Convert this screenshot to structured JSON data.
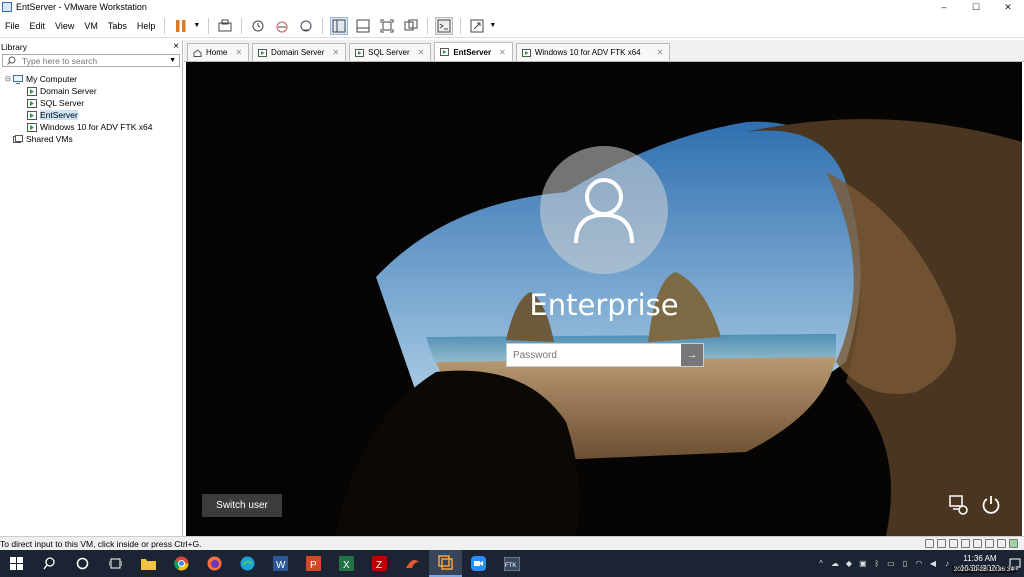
{
  "window": {
    "title": "EntServer - VMware Workstation",
    "controls": {
      "minimize": "–",
      "maximize": "☐",
      "close": "✕"
    }
  },
  "menu": {
    "items": [
      "File",
      "Edit",
      "View",
      "VM",
      "Tabs",
      "Help"
    ]
  },
  "library": {
    "title": "Library",
    "close": "×",
    "search_placeholder": "Type here to search",
    "tree": {
      "root_label": "My Computer",
      "children": [
        "Domain Server",
        "SQL Server",
        "EntServer",
        "Windows 10 for ADV FTK x64"
      ],
      "selected": "EntServer",
      "shared_label": "Shared VMs"
    }
  },
  "tabs": [
    {
      "label": "Home",
      "active": false
    },
    {
      "label": "Domain Server",
      "active": false
    },
    {
      "label": "SQL Server",
      "active": false
    },
    {
      "label": "EntServer",
      "active": true
    },
    {
      "label": "Windows 10 for ADV FTK x64",
      "active": false
    }
  ],
  "login": {
    "username": "Enterprise",
    "password_placeholder": "Password",
    "submit_arrow": "→",
    "switch_user": "Switch user"
  },
  "statusbar": {
    "text": "To direct input to this VM, click inside or press Ctrl+G."
  },
  "taskbar": {
    "clock_time": "11:36 AM",
    "clock_date": "10/28/2020",
    "stamp": "2020-10-28 10:36:34"
  },
  "colors": {
    "taskbar": "#1c2433",
    "selection": "#cce4f7",
    "pause_orange": "#e07a1f",
    "sky": "#4a90c9"
  }
}
